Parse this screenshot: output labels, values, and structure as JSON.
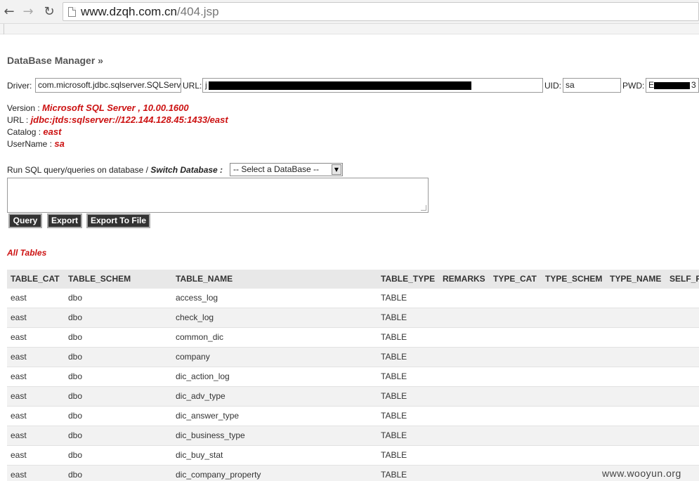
{
  "browser": {
    "back_icon": "back-arrow-icon",
    "forward_icon": "forward-arrow-icon",
    "reload_icon": "reload-icon",
    "page_icon": "page-icon",
    "url_host": "www.dzqh.com.cn",
    "url_path": "/404.jsp"
  },
  "header": {
    "title": "DataBase Manager »"
  },
  "connection": {
    "driver_label": "Driver:",
    "driver_value": "com.microsoft.jdbc.sqlserver.SQLServerDriver",
    "url_label": "URL:",
    "url_value": "j",
    "uid_label": "UID:",
    "uid_value": "sa",
    "pwd_label": "PWD:",
    "pwd_value_start": "E",
    "pwd_value_end": "3"
  },
  "info": {
    "version_label": "Version : ",
    "version_value": "Microsoft SQL Server , 10.00.1600",
    "url_label": "URL : ",
    "url_value": "jdbc:jtds:sqlserver://122.144.128.45:1433/east",
    "catalog_label": "Catalog : ",
    "catalog_value": "east",
    "username_label": "UserName : ",
    "username_value": "sa"
  },
  "sql": {
    "prompt": "Run SQL query/queries on database / ",
    "switch_label": "Switch Database :",
    "select_value": "-- Select a DataBase --",
    "query_button": "Query",
    "export_button": "Export",
    "export_file_button": "Export To File"
  },
  "tables": {
    "heading": "All Tables",
    "columns": [
      "TABLE_CAT",
      "TABLE_SCHEM",
      "TABLE_NAME",
      "TABLE_TYPE",
      "REMARKS",
      "TYPE_CAT",
      "TYPE_SCHEM",
      "TYPE_NAME",
      "SELF_R"
    ],
    "rows": [
      [
        "east",
        "dbo",
        "access_log",
        "TABLE"
      ],
      [
        "east",
        "dbo",
        "check_log",
        "TABLE"
      ],
      [
        "east",
        "dbo",
        "common_dic",
        "TABLE"
      ],
      [
        "east",
        "dbo",
        "company",
        "TABLE"
      ],
      [
        "east",
        "dbo",
        "dic_action_log",
        "TABLE"
      ],
      [
        "east",
        "dbo",
        "dic_adv_type",
        "TABLE"
      ],
      [
        "east",
        "dbo",
        "dic_answer_type",
        "TABLE"
      ],
      [
        "east",
        "dbo",
        "dic_business_type",
        "TABLE"
      ],
      [
        "east",
        "dbo",
        "dic_buy_stat",
        "TABLE"
      ],
      [
        "east",
        "dbo",
        "dic_company_property",
        "TABLE"
      ]
    ]
  },
  "watermark": "www.wooyun.org"
}
